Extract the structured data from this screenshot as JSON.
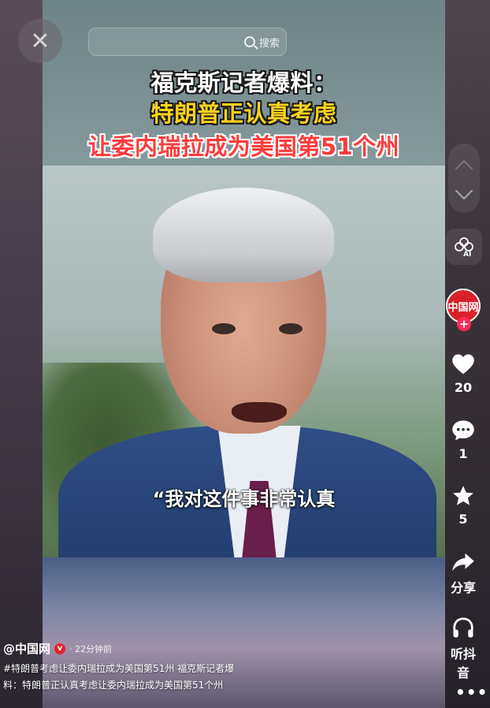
{
  "headline": {
    "line1": "福克斯记者爆料：",
    "line2": "特朗普正认真考虑",
    "line3": "让委内瑞拉成为美国第51个州"
  },
  "subtitle": "“我对这件事非常认真",
  "search": {
    "placeholder": "",
    "button_label": "搜索"
  },
  "close": {
    "icon": "close-icon",
    "symbol": "✕"
  },
  "ai": {
    "label": "AI"
  },
  "author_avatar": {
    "text": "中国网"
  },
  "follow": {
    "symbol": "+"
  },
  "actions": {
    "like_count": "20",
    "comment_count": "1",
    "favorite_count": "5",
    "share_label": "分享",
    "listen_label": "听抖音"
  },
  "more": {
    "symbol": "•••"
  },
  "post": {
    "author": "@中国网",
    "verified_symbol": "v",
    "time": "· 22分钟前",
    "description": "#特朗普考虑让委内瑞拉成为美国第51州 福克斯记者爆料：特朗普正认真考虑让委内瑞拉成为美国第51个州"
  },
  "colors": {
    "headline_white": "#ffffff",
    "headline_yellow": "#ffd21e",
    "headline_red": "#ff3b3b",
    "follow_red": "#fe2c55",
    "avatar_red": "#d8212a"
  }
}
